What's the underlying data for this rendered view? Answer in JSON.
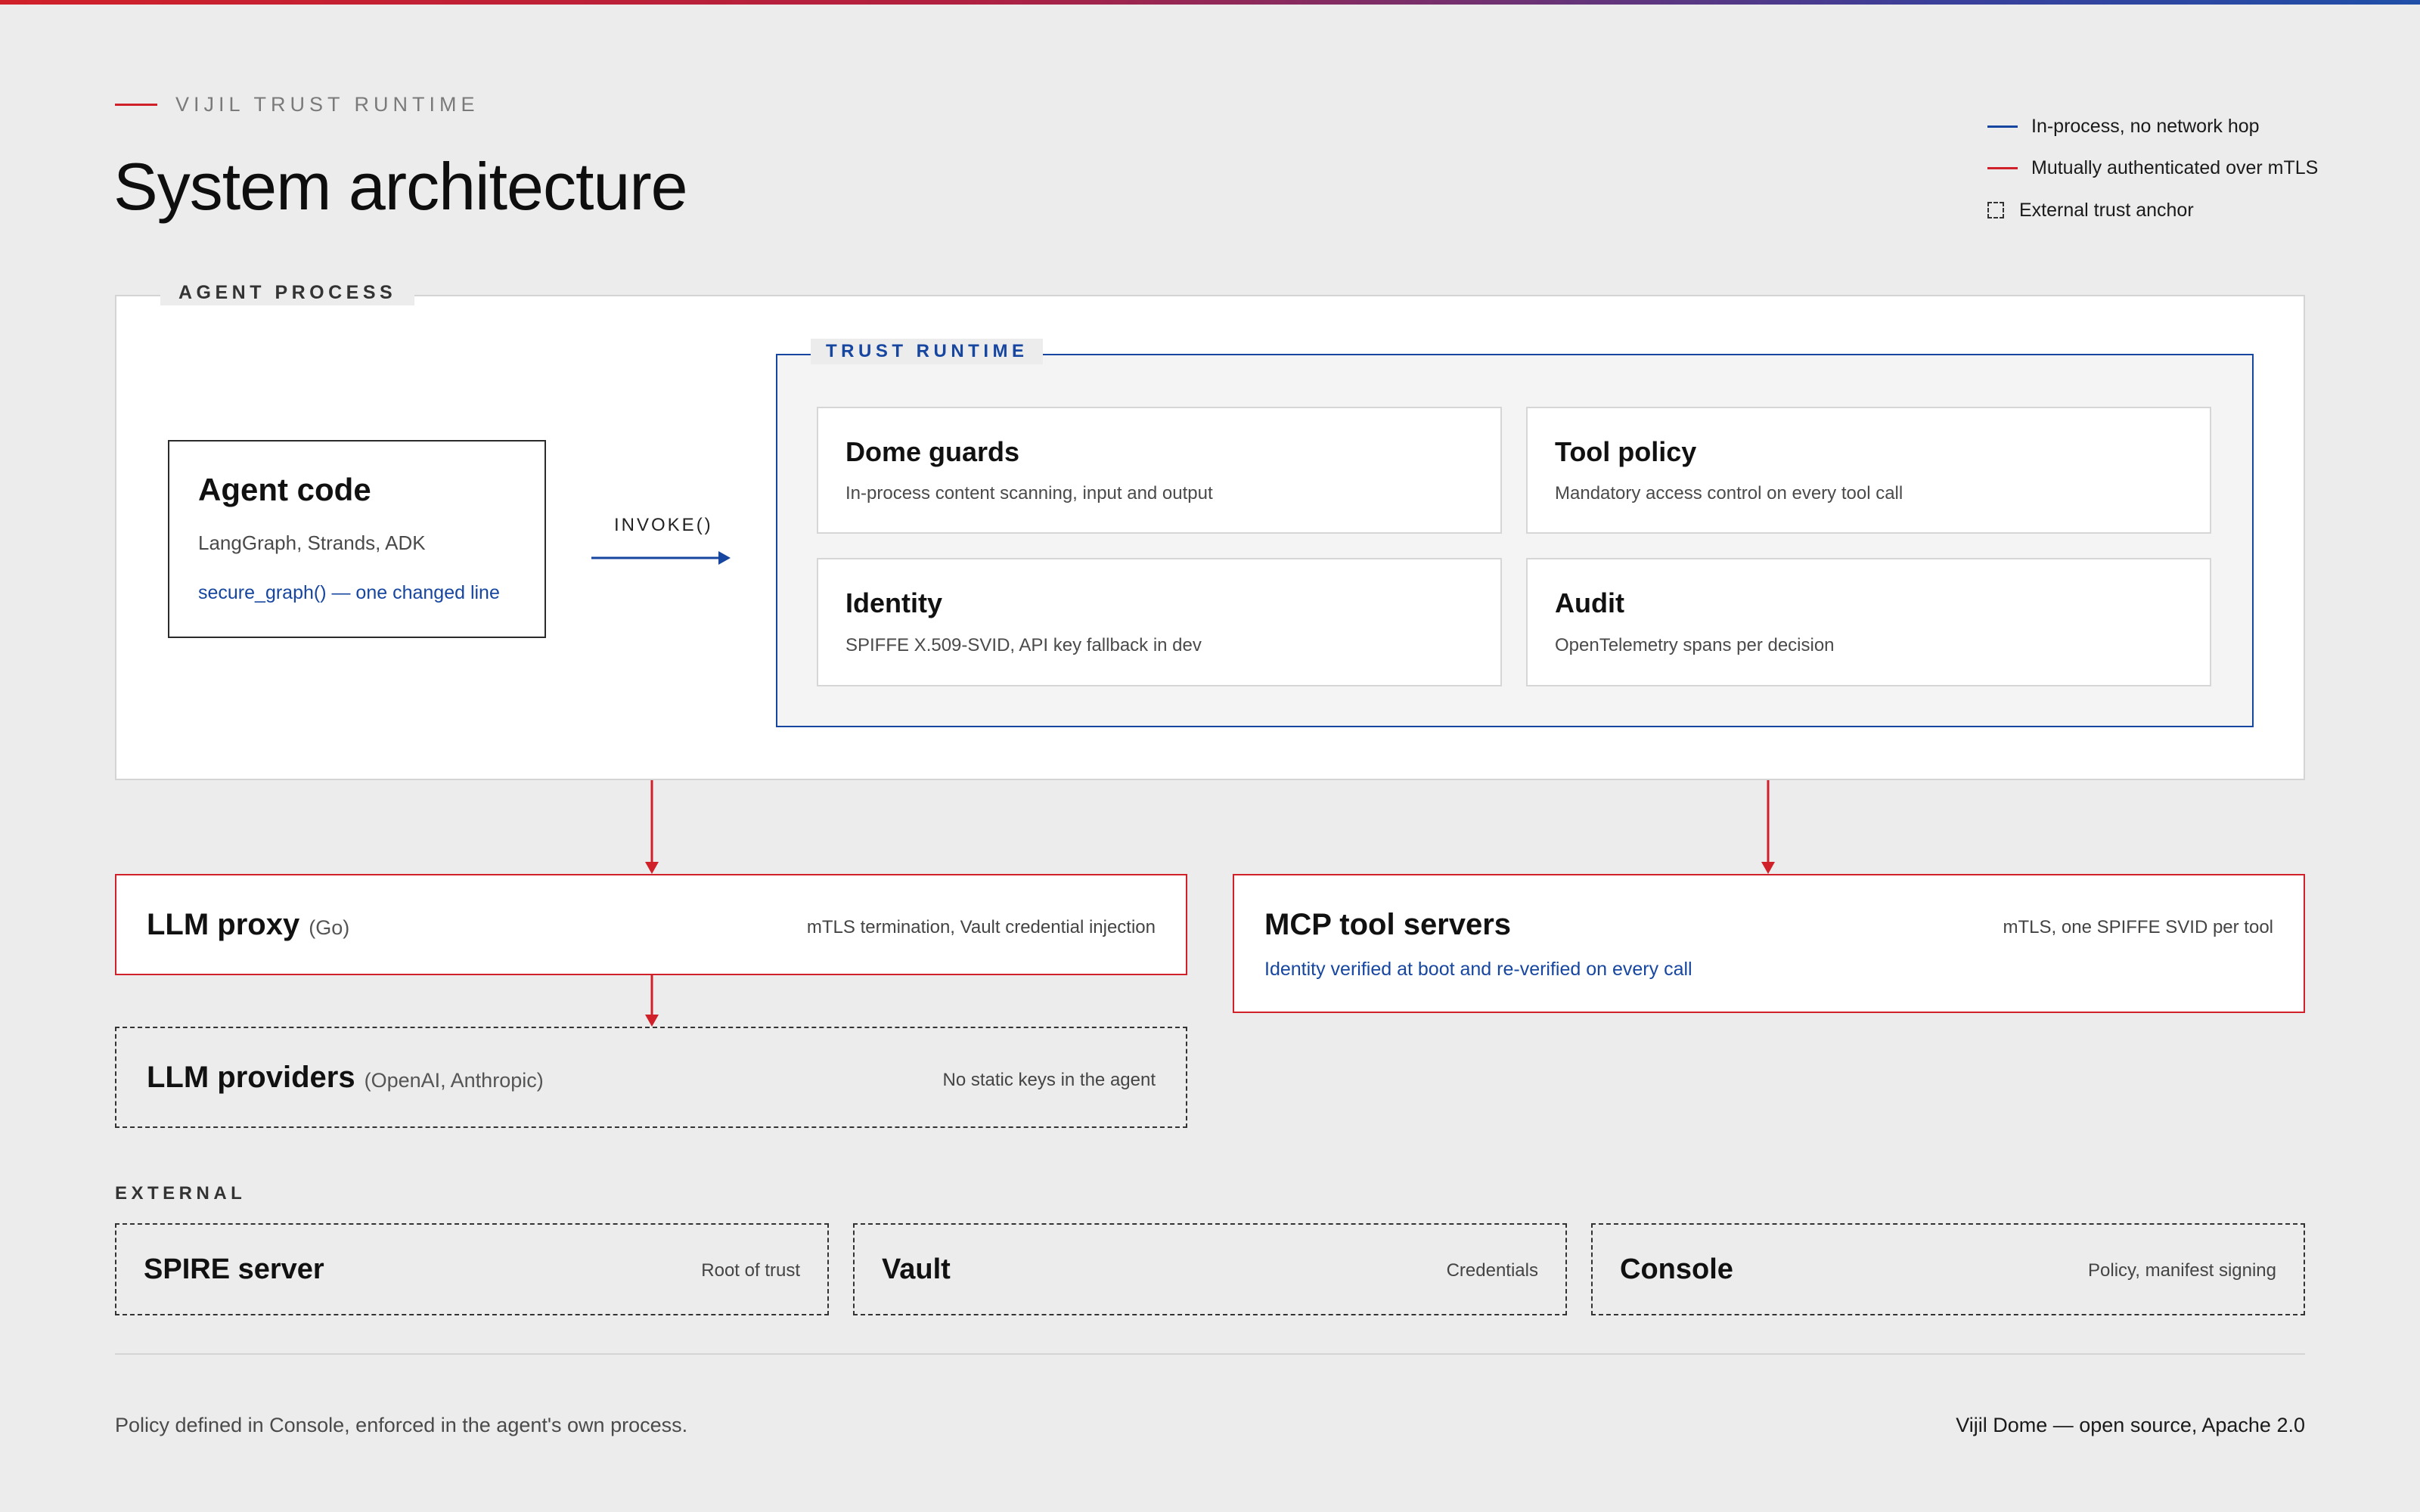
{
  "header": {
    "eyebrow": "VIJIL TRUST RUNTIME",
    "title": "System architecture"
  },
  "legend": {
    "items": [
      {
        "label": "In-process, no network hop",
        "color": "#1646a0",
        "style": "line"
      },
      {
        "label": "Mutually authenticated over mTLS",
        "color": "#d0202a",
        "style": "line"
      },
      {
        "label": "External trust anchor",
        "color": "#333333",
        "style": "dashed-box"
      }
    ]
  },
  "agent_process": {
    "label": "AGENT PROCESS",
    "agent_code": {
      "title": "Agent code",
      "subtitle": "LangGraph, Strands, ADK",
      "link": "secure_graph() — one changed line"
    },
    "invoke_label": "INVOKE()",
    "trust_runtime": {
      "label": "TRUST RUNTIME",
      "cards": [
        {
          "title": "Dome guards",
          "subtitle": "In-process content scanning, input and output"
        },
        {
          "title": "Tool policy",
          "subtitle": "Mandatory access control on every tool call"
        },
        {
          "title": "Identity",
          "subtitle": "SPIFFE X.509-SVID, API key fallback in dev"
        },
        {
          "title": "Audit",
          "subtitle": "OpenTelemetry spans per decision"
        }
      ]
    }
  },
  "services": {
    "llm_proxy": {
      "title": "LLM proxy",
      "note": "(Go)",
      "detail": "mTLS termination, Vault credential injection"
    },
    "mcp_tool_servers": {
      "title": "MCP tool servers",
      "detail": "mTLS, one SPIFFE SVID per tool",
      "link": "Identity verified at boot and re-verified on every call"
    },
    "llm_providers": {
      "title": "LLM providers",
      "note": "(OpenAI, Anthropic)",
      "detail": "No static keys in the agent"
    }
  },
  "external": {
    "label": "EXTERNAL",
    "items": [
      {
        "title": "SPIRE server",
        "detail": "Root of trust"
      },
      {
        "title": "Vault",
        "detail": "Credentials"
      },
      {
        "title": "Console",
        "detail": "Policy, manifest signing"
      }
    ]
  },
  "footer": {
    "left": "Policy defined in Console, enforced in the agent's own process.",
    "right": "Vijil Dome — open source, Apache 2.0"
  },
  "colors": {
    "accent_red": "#d0202a",
    "accent_blue": "#1646a0",
    "background": "#ececec"
  }
}
